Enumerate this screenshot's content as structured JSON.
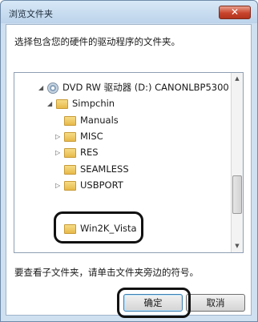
{
  "window": {
    "title": "浏览文件夹",
    "close_glyph": "✕"
  },
  "instruction": "选择包含您的硬件的驱动程序的文件夹。",
  "tree": {
    "items": [
      {
        "label": "DVD RW 驱动器 (D:) CANONLBP5300",
        "expander": "◢",
        "icon": "dvd-drive-icon"
      },
      {
        "label": "Simpchin",
        "expander": "◢",
        "icon": "folder-icon"
      },
      {
        "label": "Manuals",
        "expander": "",
        "icon": "folder-icon"
      },
      {
        "label": "MISC",
        "expander": "▷",
        "icon": "folder-icon"
      },
      {
        "label": "RES",
        "expander": "▷",
        "icon": "folder-icon"
      },
      {
        "label": "SEAMLESS",
        "expander": "",
        "icon": "folder-icon"
      },
      {
        "label": "USBPORT",
        "expander": "▷",
        "icon": "folder-icon"
      },
      {
        "label": "Win2K_Vista",
        "expander": "",
        "icon": "folder-icon"
      }
    ],
    "scroll_up": "▲",
    "scroll_down": "▼"
  },
  "hint": "要查看子文件夹，请单击文件夹旁边的符号。",
  "buttons": {
    "ok": "确定",
    "cancel": "取消"
  },
  "colors": {
    "close_button": "#c8442c",
    "title_bar": "#bcd3ea",
    "folder": "#e7b94a"
  }
}
